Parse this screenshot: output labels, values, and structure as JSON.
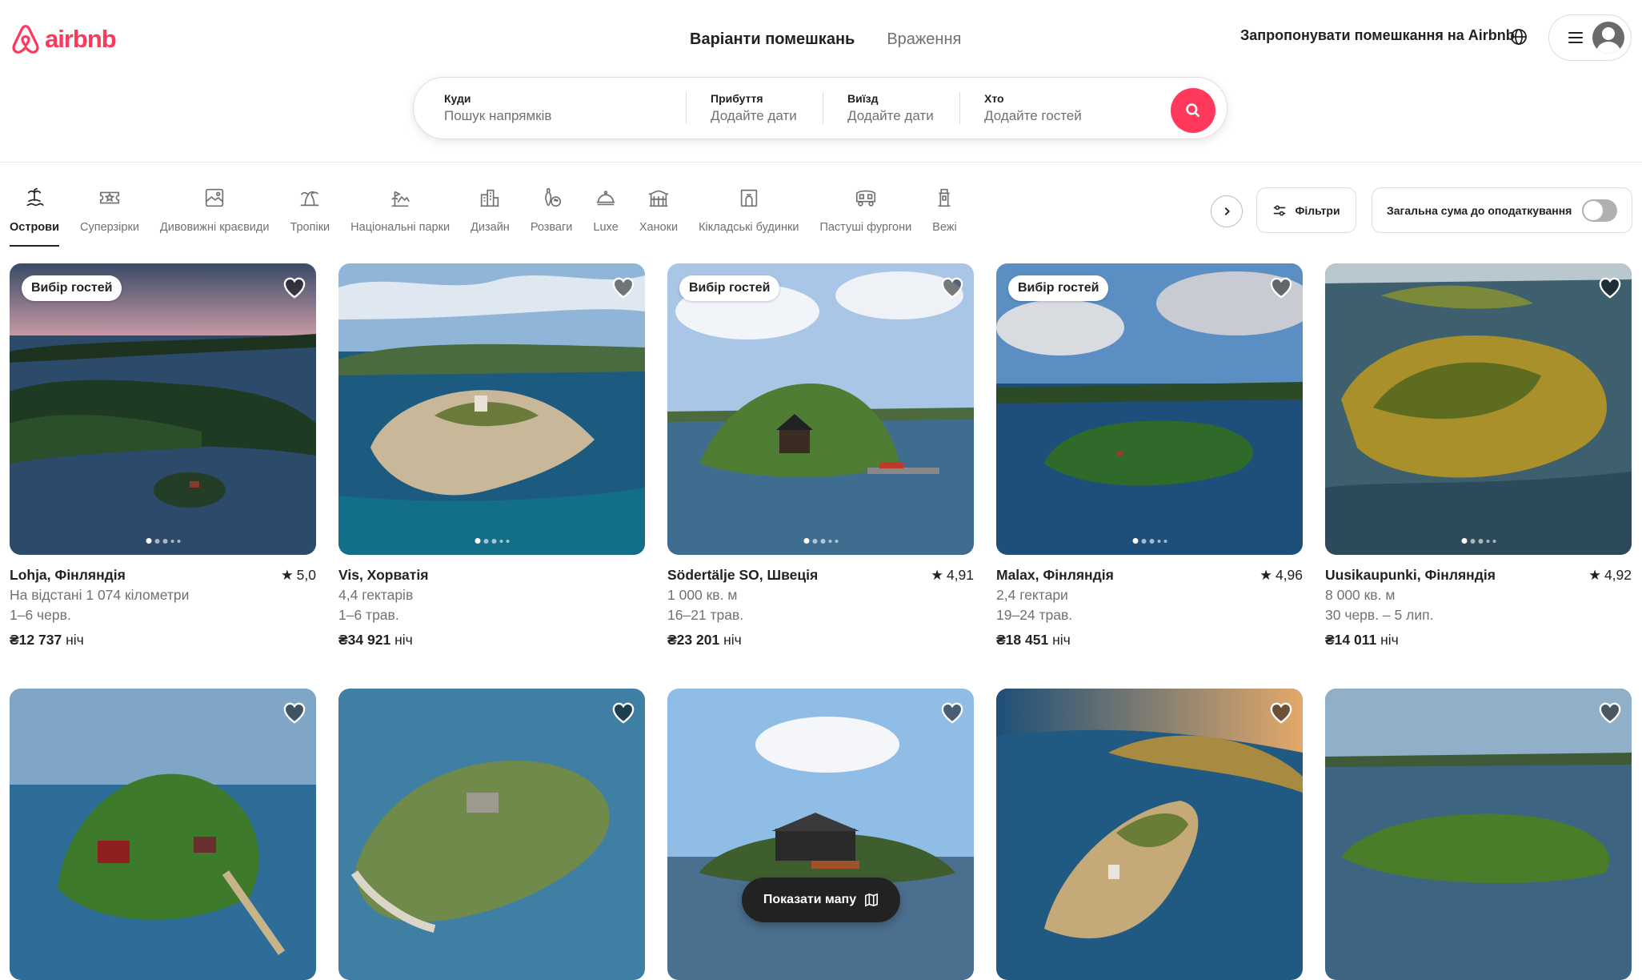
{
  "brand": {
    "name": "airbnb",
    "color": "#ff385c"
  },
  "header": {
    "tabs": [
      {
        "label": "Варіанти помешкань",
        "active": true
      },
      {
        "label": "Враження",
        "active": false
      }
    ],
    "host_link": "Запропонувати помешкання на Airbnb"
  },
  "search": {
    "where": {
      "label": "Куди",
      "placeholder": "Пошук напрямків"
    },
    "checkin": {
      "label": "Прибуття",
      "placeholder": "Додайте дати"
    },
    "checkout": {
      "label": "Виїзд",
      "placeholder": "Додайте дати"
    },
    "guests": {
      "label": "Хто",
      "placeholder": "Додайте гостей"
    }
  },
  "categories": [
    {
      "label": "Острови",
      "icon": "island-icon",
      "active": true
    },
    {
      "label": "Суперзірки",
      "icon": "ticket-star-icon"
    },
    {
      "label": "Дивовижні краєвиди",
      "icon": "landscape-frame-icon"
    },
    {
      "label": "Тропіки",
      "icon": "palm-tree-icon"
    },
    {
      "label": "Національні парки",
      "icon": "national-park-icon"
    },
    {
      "label": "Дизайн",
      "icon": "design-building-icon"
    },
    {
      "label": "Розваги",
      "icon": "bowling-icon"
    },
    {
      "label": "Luxe",
      "icon": "cloche-icon"
    },
    {
      "label": "Ханоки",
      "icon": "hanok-icon"
    },
    {
      "label": "Кікладські будинки",
      "icon": "cycladic-house-icon"
    },
    {
      "label": "Пастуші фургони",
      "icon": "wagon-icon"
    },
    {
      "label": "Вежі",
      "icon": "tower-icon"
    }
  ],
  "filters": {
    "label": "Фільтри"
  },
  "tax_toggle": {
    "label": "Загальна сума до оподаткування",
    "on": false
  },
  "listings": [
    {
      "badge": "Вибір гостей",
      "location": "Lohja, Фінляндія",
      "rating": "5,0",
      "line1": "На відстані 1 074 кілометри",
      "dates": "1–6 черв.",
      "price": "₴12 737",
      "per": "ніч"
    },
    {
      "badge": "",
      "location": "Vis, Хорватія",
      "rating": "",
      "line1": "4,4 гектарів",
      "dates": "1–6 трав.",
      "price": "₴34 921",
      "per": "ніч"
    },
    {
      "badge": "Вибір гостей",
      "location": "Södertälje SO, Швеція",
      "rating": "4,91",
      "line1": "1 000 кв. м",
      "dates": "16–21 трав.",
      "price": "₴23 201",
      "per": "ніч"
    },
    {
      "badge": "Вибір гостей",
      "location": "Malax, Фінляндія",
      "rating": "4,96",
      "line1": "2,4 гектари",
      "dates": "19–24 трав.",
      "price": "₴18 451",
      "per": "ніч"
    },
    {
      "badge": "",
      "location": "Uusikaupunki, Фінляндія",
      "rating": "4,92",
      "line1": "8 000 кв. м",
      "dates": "30 черв. – 5 лип.",
      "price": "₴14 011",
      "per": "ніч"
    },
    {
      "badge": ""
    },
    {
      "badge": ""
    },
    {
      "badge": ""
    },
    {
      "badge": ""
    },
    {
      "badge": ""
    }
  ],
  "map_button": {
    "label": "Показати мапу"
  }
}
